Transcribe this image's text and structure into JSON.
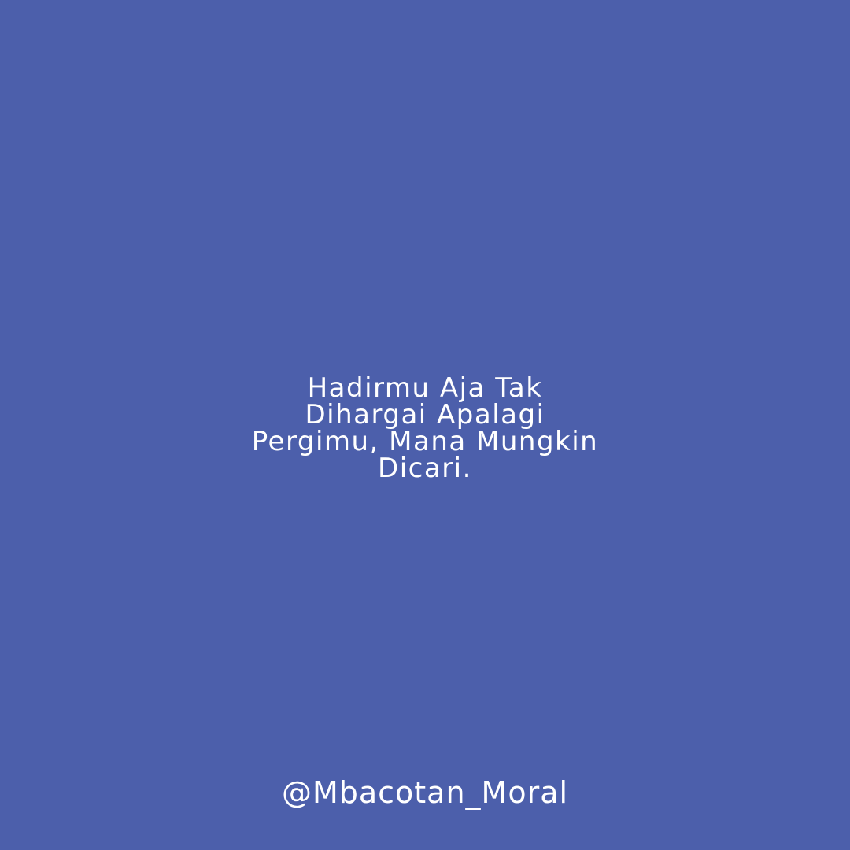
{
  "background_color": "#4C5FAB",
  "text_color": "#FFFFFF",
  "quote": {
    "lines": [
      "Hadirmu Aja Tak",
      "Dihargai Apalagi",
      "Pergimu, Mana Mungkin",
      "Dicari."
    ]
  },
  "footer": {
    "handle": "@Mbacotan_Moral"
  }
}
